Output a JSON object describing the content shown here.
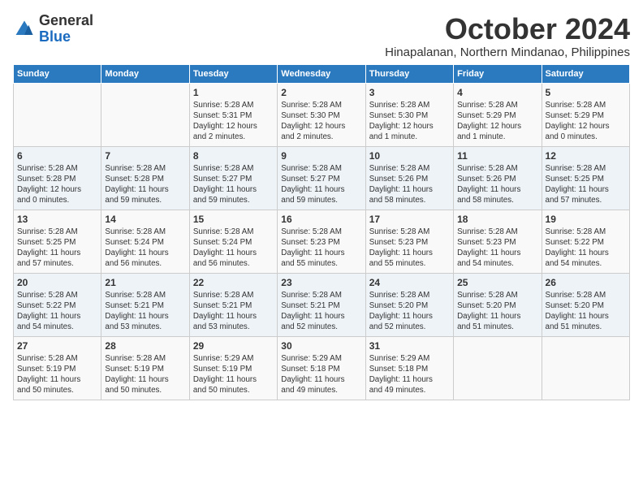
{
  "header": {
    "logo_general": "General",
    "logo_blue": "Blue",
    "month_year": "October 2024",
    "location": "Hinapalanan, Northern Mindanao, Philippines"
  },
  "days_of_week": [
    "Sunday",
    "Monday",
    "Tuesday",
    "Wednesday",
    "Thursday",
    "Friday",
    "Saturday"
  ],
  "weeks": [
    [
      {
        "day": "",
        "info": ""
      },
      {
        "day": "",
        "info": ""
      },
      {
        "day": "1",
        "info": "Sunrise: 5:28 AM\nSunset: 5:31 PM\nDaylight: 12 hours\nand 2 minutes."
      },
      {
        "day": "2",
        "info": "Sunrise: 5:28 AM\nSunset: 5:30 PM\nDaylight: 12 hours\nand 2 minutes."
      },
      {
        "day": "3",
        "info": "Sunrise: 5:28 AM\nSunset: 5:30 PM\nDaylight: 12 hours\nand 1 minute."
      },
      {
        "day": "4",
        "info": "Sunrise: 5:28 AM\nSunset: 5:29 PM\nDaylight: 12 hours\nand 1 minute."
      },
      {
        "day": "5",
        "info": "Sunrise: 5:28 AM\nSunset: 5:29 PM\nDaylight: 12 hours\nand 0 minutes."
      }
    ],
    [
      {
        "day": "6",
        "info": "Sunrise: 5:28 AM\nSunset: 5:28 PM\nDaylight: 12 hours\nand 0 minutes."
      },
      {
        "day": "7",
        "info": "Sunrise: 5:28 AM\nSunset: 5:28 PM\nDaylight: 11 hours\nand 59 minutes."
      },
      {
        "day": "8",
        "info": "Sunrise: 5:28 AM\nSunset: 5:27 PM\nDaylight: 11 hours\nand 59 minutes."
      },
      {
        "day": "9",
        "info": "Sunrise: 5:28 AM\nSunset: 5:27 PM\nDaylight: 11 hours\nand 59 minutes."
      },
      {
        "day": "10",
        "info": "Sunrise: 5:28 AM\nSunset: 5:26 PM\nDaylight: 11 hours\nand 58 minutes."
      },
      {
        "day": "11",
        "info": "Sunrise: 5:28 AM\nSunset: 5:26 PM\nDaylight: 11 hours\nand 58 minutes."
      },
      {
        "day": "12",
        "info": "Sunrise: 5:28 AM\nSunset: 5:25 PM\nDaylight: 11 hours\nand 57 minutes."
      }
    ],
    [
      {
        "day": "13",
        "info": "Sunrise: 5:28 AM\nSunset: 5:25 PM\nDaylight: 11 hours\nand 57 minutes."
      },
      {
        "day": "14",
        "info": "Sunrise: 5:28 AM\nSunset: 5:24 PM\nDaylight: 11 hours\nand 56 minutes."
      },
      {
        "day": "15",
        "info": "Sunrise: 5:28 AM\nSunset: 5:24 PM\nDaylight: 11 hours\nand 56 minutes."
      },
      {
        "day": "16",
        "info": "Sunrise: 5:28 AM\nSunset: 5:23 PM\nDaylight: 11 hours\nand 55 minutes."
      },
      {
        "day": "17",
        "info": "Sunrise: 5:28 AM\nSunset: 5:23 PM\nDaylight: 11 hours\nand 55 minutes."
      },
      {
        "day": "18",
        "info": "Sunrise: 5:28 AM\nSunset: 5:23 PM\nDaylight: 11 hours\nand 54 minutes."
      },
      {
        "day": "19",
        "info": "Sunrise: 5:28 AM\nSunset: 5:22 PM\nDaylight: 11 hours\nand 54 minutes."
      }
    ],
    [
      {
        "day": "20",
        "info": "Sunrise: 5:28 AM\nSunset: 5:22 PM\nDaylight: 11 hours\nand 54 minutes."
      },
      {
        "day": "21",
        "info": "Sunrise: 5:28 AM\nSunset: 5:21 PM\nDaylight: 11 hours\nand 53 minutes."
      },
      {
        "day": "22",
        "info": "Sunrise: 5:28 AM\nSunset: 5:21 PM\nDaylight: 11 hours\nand 53 minutes."
      },
      {
        "day": "23",
        "info": "Sunrise: 5:28 AM\nSunset: 5:21 PM\nDaylight: 11 hours\nand 52 minutes."
      },
      {
        "day": "24",
        "info": "Sunrise: 5:28 AM\nSunset: 5:20 PM\nDaylight: 11 hours\nand 52 minutes."
      },
      {
        "day": "25",
        "info": "Sunrise: 5:28 AM\nSunset: 5:20 PM\nDaylight: 11 hours\nand 51 minutes."
      },
      {
        "day": "26",
        "info": "Sunrise: 5:28 AM\nSunset: 5:20 PM\nDaylight: 11 hours\nand 51 minutes."
      }
    ],
    [
      {
        "day": "27",
        "info": "Sunrise: 5:28 AM\nSunset: 5:19 PM\nDaylight: 11 hours\nand 50 minutes."
      },
      {
        "day": "28",
        "info": "Sunrise: 5:28 AM\nSunset: 5:19 PM\nDaylight: 11 hours\nand 50 minutes."
      },
      {
        "day": "29",
        "info": "Sunrise: 5:29 AM\nSunset: 5:19 PM\nDaylight: 11 hours\nand 50 minutes."
      },
      {
        "day": "30",
        "info": "Sunrise: 5:29 AM\nSunset: 5:18 PM\nDaylight: 11 hours\nand 49 minutes."
      },
      {
        "day": "31",
        "info": "Sunrise: 5:29 AM\nSunset: 5:18 PM\nDaylight: 11 hours\nand 49 minutes."
      },
      {
        "day": "",
        "info": ""
      },
      {
        "day": "",
        "info": ""
      }
    ]
  ]
}
